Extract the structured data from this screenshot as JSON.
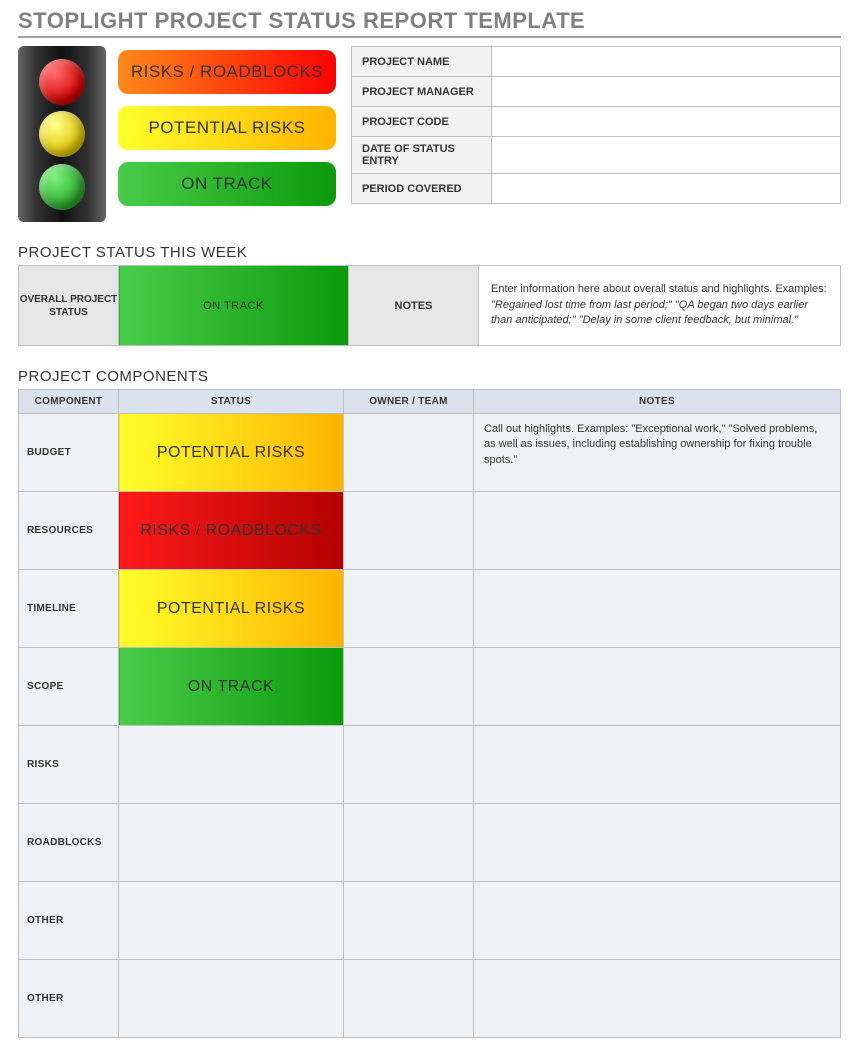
{
  "title": "STOPLIGHT PROJECT STATUS REPORT TEMPLATE",
  "legend": {
    "red": "RISKS / ROADBLOCKS",
    "yellow": "POTENTIAL RISKS",
    "green": "ON TRACK"
  },
  "info_fields": [
    {
      "label": "PROJECT NAME",
      "value": ""
    },
    {
      "label": "PROJECT MANAGER",
      "value": ""
    },
    {
      "label": "PROJECT CODE",
      "value": ""
    },
    {
      "label": "DATE OF STATUS ENTRY",
      "value": ""
    },
    {
      "label": "PERIOD COVERED",
      "value": ""
    }
  ],
  "status_week": {
    "section_label": "PROJECT STATUS THIS WEEK",
    "overall_label": "OVERALL PROJECT STATUS",
    "overall_value": "ON TRACK",
    "overall_color": "green",
    "notes_label": "NOTES",
    "notes_text": "Enter information here about overall status and highlights. Examples: \"Regained lost time from last period;\" \"QA began two days earlier than anticipated;\" \"Delay in some client feedback, but minimal.\""
  },
  "components": {
    "section_label": "PROJECT COMPONENTS",
    "headers": {
      "component": "COMPONENT",
      "status": "STATUS",
      "owner": "OWNER / TEAM",
      "notes": "NOTES"
    },
    "rows": [
      {
        "component": "BUDGET",
        "status": "POTENTIAL RISKS",
        "color": "yellow",
        "owner": "",
        "notes": "Call out highlights. Examples: \"Exceptional work,\" \"Solved problems, as well as issues, including establishing ownership for fixing trouble spots.\""
      },
      {
        "component": "RESOURCES",
        "status": "RISKS / ROADBLOCKS",
        "color": "red",
        "owner": "",
        "notes": ""
      },
      {
        "component": "TIMELINE",
        "status": "POTENTIAL RISKS",
        "color": "yellow",
        "owner": "",
        "notes": ""
      },
      {
        "component": "SCOPE",
        "status": "ON TRACK",
        "color": "green",
        "owner": "",
        "notes": ""
      },
      {
        "component": "RISKS",
        "status": "",
        "color": "",
        "owner": "",
        "notes": ""
      },
      {
        "component": "ROADBLOCKS",
        "status": "",
        "color": "",
        "owner": "",
        "notes": ""
      },
      {
        "component": "OTHER",
        "status": "",
        "color": "",
        "owner": "",
        "notes": ""
      },
      {
        "component": "OTHER",
        "status": "",
        "color": "",
        "owner": "",
        "notes": ""
      }
    ]
  }
}
